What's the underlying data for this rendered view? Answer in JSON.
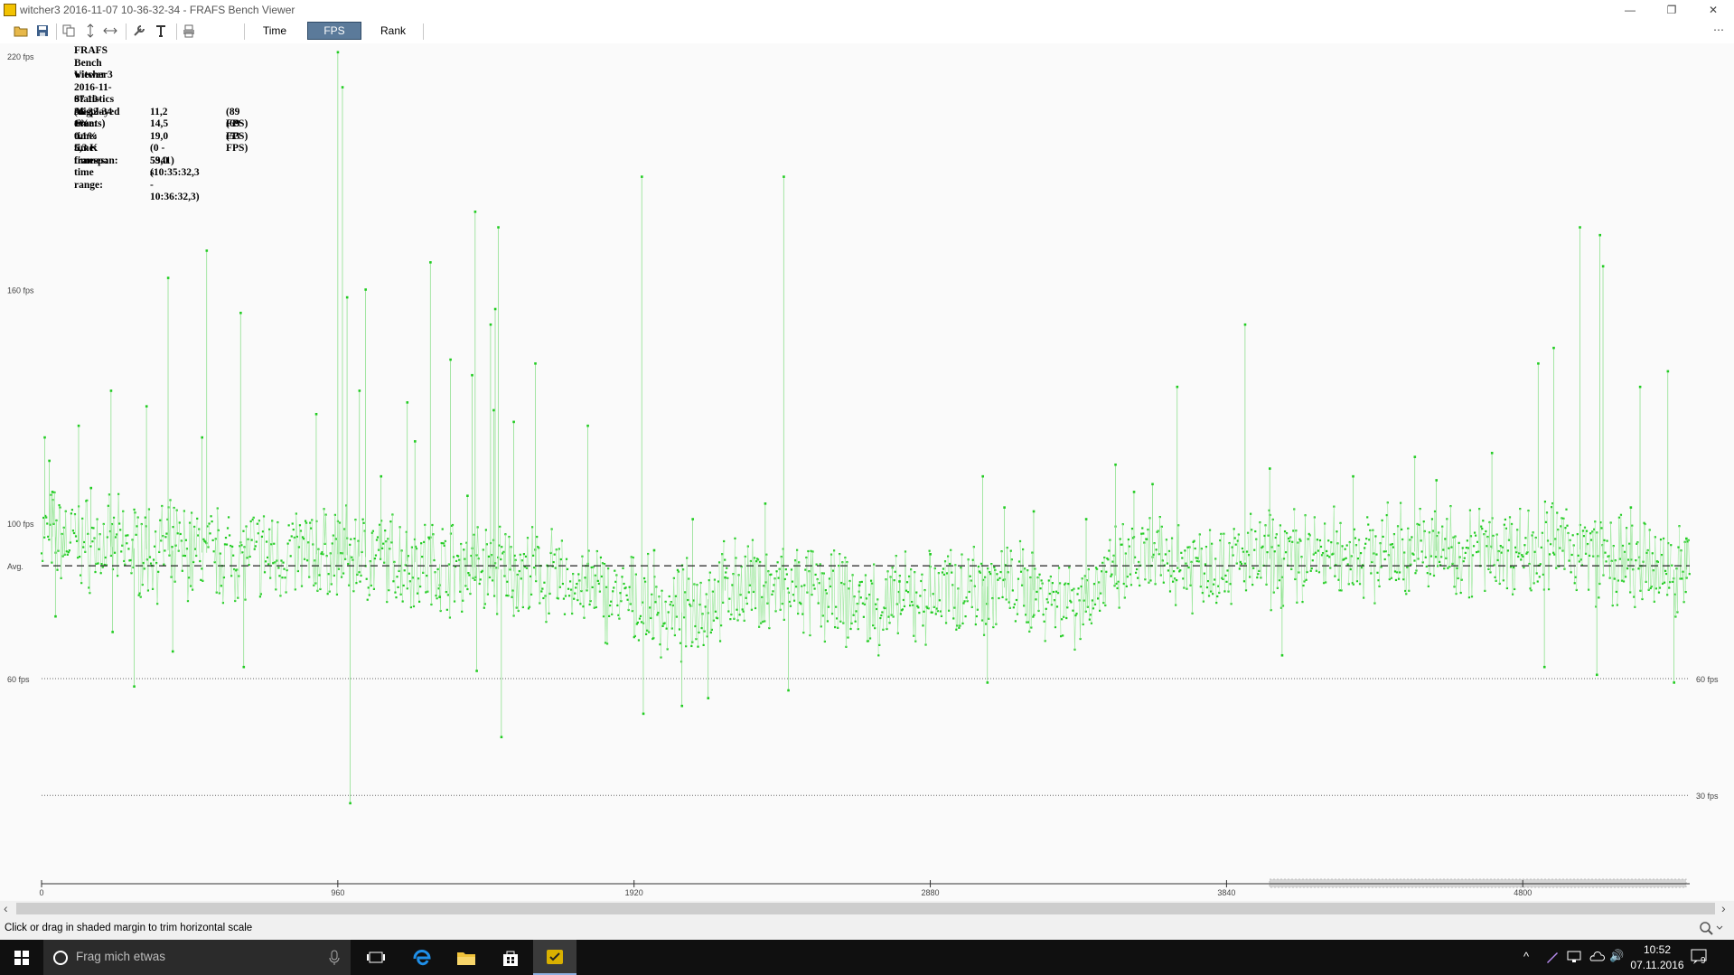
{
  "window": {
    "title": "witcher3 2016-11-07 10-36-32-34 - FRAFS Bench Viewer",
    "minimize_glyph": "—",
    "restore_glyph": "❐",
    "close_glyph": "✕"
  },
  "toolbar": {
    "tabs": [
      "Time",
      "FPS",
      "Rank"
    ],
    "active_tab": "FPS",
    "icons": [
      "open-folder-icon",
      "save-icon",
      "copy-icon",
      "fit-vertical-icon",
      "fit-horizontal-icon",
      "settings-wrench-icon",
      "text-icon",
      "print-icon"
    ],
    "overflow_glyph": "⋯"
  },
  "stats": {
    "app_name": "FRAFS Bench Viewer",
    "file_name": "witcher3 2016-11-07 10-36-32-34",
    "heading": "Statistics (displayed events)",
    "rows": [
      {
        "label": "Avg. time:",
        "value": "11,2",
        "extra": "(89 FPS)"
      },
      {
        "label": "1% time:",
        "value": "14,5",
        "extra": "(69 FPS)"
      },
      {
        "label": "0.1% time:",
        "value": "19,0",
        "extra": "(53 FPS)"
      },
      {
        "label": "5,3 K frames:",
        "value": "(0 - 5341)",
        "extra": ""
      },
      {
        "label": "timespan:",
        "value": "59,0 s",
        "extra": ""
      },
      {
        "label": "time range:",
        "value": "(10:35:32,3 - 10:36:32,3)",
        "extra": ""
      }
    ]
  },
  "chart_data": {
    "type": "scatter",
    "y_unit": "fps",
    "ylim": [
      20,
      220
    ],
    "xlim": [
      0,
      5341
    ],
    "y_tick_labels": [
      {
        "value": 220,
        "label": "220 fps"
      },
      {
        "value": 160,
        "label": "160 fps"
      },
      {
        "value": 100,
        "label": "100 fps"
      },
      {
        "value": 60,
        "label": "60 fps"
      }
    ],
    "avg": {
      "value": 89,
      "label": "Avg."
    },
    "threshold_lines": [
      {
        "value": 60,
        "label": "60 fps"
      },
      {
        "value": 30,
        "label": "30 fps"
      }
    ],
    "x_ticks": [
      0,
      960,
      1920,
      2880,
      3840,
      4800
    ],
    "x_tick_labels": [
      "0",
      "960",
      "1920",
      "2880",
      "3840",
      "4800"
    ],
    "series_color": "#22cc22",
    "baseline": [
      [
        0,
        97
      ],
      [
        200,
        94
      ],
      [
        600,
        92
      ],
      [
        960,
        92
      ],
      [
        1200,
        90
      ],
      [
        1500,
        88
      ],
      [
        1700,
        85
      ],
      [
        1850,
        81
      ],
      [
        2050,
        76
      ],
      [
        2250,
        84
      ],
      [
        2500,
        82
      ],
      [
        2700,
        78
      ],
      [
        2880,
        81
      ],
      [
        3000,
        84
      ],
      [
        3200,
        83
      ],
      [
        3350,
        80
      ],
      [
        3550,
        90
      ],
      [
        3840,
        90
      ],
      [
        4200,
        92
      ],
      [
        4600,
        93
      ],
      [
        4960,
        94
      ],
      [
        5150,
        88
      ],
      [
        5341,
        88
      ]
    ],
    "spikes": [
      [
        10,
        122
      ],
      [
        25,
        116
      ],
      [
        35,
        108
      ],
      [
        45,
        76
      ],
      [
        120,
        125
      ],
      [
        160,
        109
      ],
      [
        225,
        134
      ],
      [
        230,
        72
      ],
      [
        300,
        58
      ],
      [
        340,
        130
      ],
      [
        410,
        163
      ],
      [
        425,
        67
      ],
      [
        520,
        122
      ],
      [
        535,
        170
      ],
      [
        645,
        154
      ],
      [
        655,
        63
      ],
      [
        890,
        128
      ],
      [
        960,
        221
      ],
      [
        975,
        212
      ],
      [
        990,
        158
      ],
      [
        1000,
        28
      ],
      [
        1030,
        134
      ],
      [
        1050,
        160
      ],
      [
        1100,
        112
      ],
      [
        1185,
        131
      ],
      [
        1210,
        121
      ],
      [
        1260,
        167
      ],
      [
        1290,
        81
      ],
      [
        1325,
        142
      ],
      [
        1380,
        107
      ],
      [
        1395,
        138
      ],
      [
        1405,
        180
      ],
      [
        1410,
        62
      ],
      [
        1455,
        151
      ],
      [
        1465,
        129
      ],
      [
        1470,
        155
      ],
      [
        1480,
        176
      ],
      [
        1490,
        45
      ],
      [
        1530,
        126
      ],
      [
        1600,
        141
      ],
      [
        1770,
        125
      ],
      [
        1945,
        189
      ],
      [
        1950,
        51
      ],
      [
        1985,
        93
      ],
      [
        2075,
        53
      ],
      [
        2110,
        101
      ],
      [
        2160,
        55
      ],
      [
        2215,
        86
      ],
      [
        2345,
        105
      ],
      [
        2405,
        189
      ],
      [
        2420,
        57
      ],
      [
        2650,
        84
      ],
      [
        2780,
        85
      ],
      [
        2880,
        92
      ],
      [
        3050,
        112
      ],
      [
        3065,
        59
      ],
      [
        3120,
        104
      ],
      [
        3215,
        103
      ],
      [
        3385,
        101
      ],
      [
        3480,
        115
      ],
      [
        3540,
        108
      ],
      [
        3600,
        110
      ],
      [
        3680,
        135
      ],
      [
        3900,
        151
      ],
      [
        3980,
        114
      ],
      [
        4020,
        66
      ],
      [
        4250,
        112
      ],
      [
        4450,
        117
      ],
      [
        4520,
        111
      ],
      [
        4700,
        118
      ],
      [
        4850,
        141
      ],
      [
        4870,
        63
      ],
      [
        4900,
        145
      ],
      [
        4985,
        176
      ],
      [
        5040,
        61
      ],
      [
        5050,
        174
      ],
      [
        5060,
        166
      ],
      [
        5150,
        104
      ],
      [
        5180,
        135
      ],
      [
        5270,
        139
      ],
      [
        5290,
        59
      ],
      [
        5330,
        96
      ]
    ]
  },
  "scroll_arrows": {
    "left": "‹",
    "right": "›"
  },
  "status": {
    "text": "Click or drag in shaded margin to trim horizontal scale"
  },
  "taskbar": {
    "search_placeholder": "Frag mich etwas",
    "time": "10:52",
    "date": "07.11.2016",
    "notification_count": "9",
    "tray_glyphs": {
      "chevron": "^",
      "volume": "🔊"
    }
  }
}
